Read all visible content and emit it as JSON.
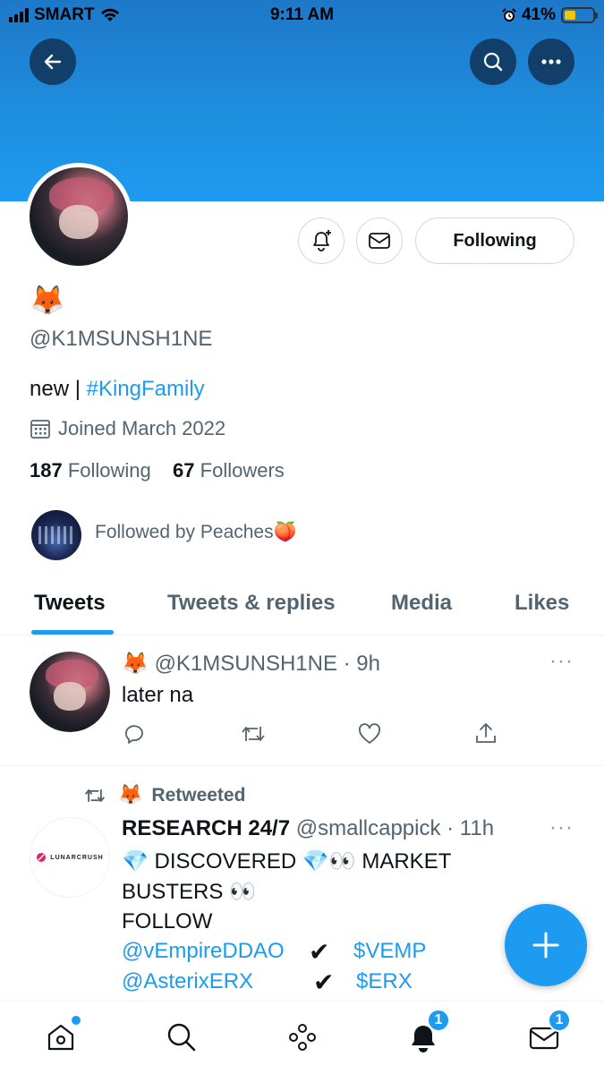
{
  "status_bar": {
    "carrier": "SMART",
    "time": "9:11 AM",
    "battery": "41%",
    "battery_level": 0.41
  },
  "profile": {
    "display_name": "🦊",
    "handle": "@K1MSUNSH1NE",
    "bio_text": "new |",
    "bio_hashtag": "#KingFamily",
    "joined": "Joined March 2022",
    "following_count": "187",
    "following_label": "Following",
    "followers_count": "67",
    "followers_label": "Followers",
    "followed_by": "Followed by Peaches🍑",
    "follow_button": "Following"
  },
  "tabs": [
    {
      "label": "Tweets",
      "active": true
    },
    {
      "label": "Tweets & replies",
      "active": false
    },
    {
      "label": "Media",
      "active": false
    },
    {
      "label": "Likes",
      "active": false
    }
  ],
  "tweets": [
    {
      "name": "🦊",
      "handle_time": "@K1MSUNSH1NE · 9h",
      "text": "later na"
    },
    {
      "retweet_label": "Retweeted",
      "retweeter": "🦊",
      "author": "RESEARCH 24/7",
      "handle_time": "@smallcappick · 11h",
      "line1": "💎 DISCOVERED 💎👀 MARKET",
      "line2": "BUSTERS 👀",
      "line3": "FOLLOW",
      "mention1": "@vEmpireDDAO",
      "cashtag1": "$VEMP",
      "mention2": "@AsterixERX",
      "cashtag2": "$ERX",
      "check": "✔",
      "avatar_logo": "LUNARCRUSH"
    }
  ],
  "nav": {
    "notifications_badge": "1",
    "messages_badge": "1"
  },
  "colors": {
    "accent": "#1d9bf0",
    "muted": "#536471"
  }
}
